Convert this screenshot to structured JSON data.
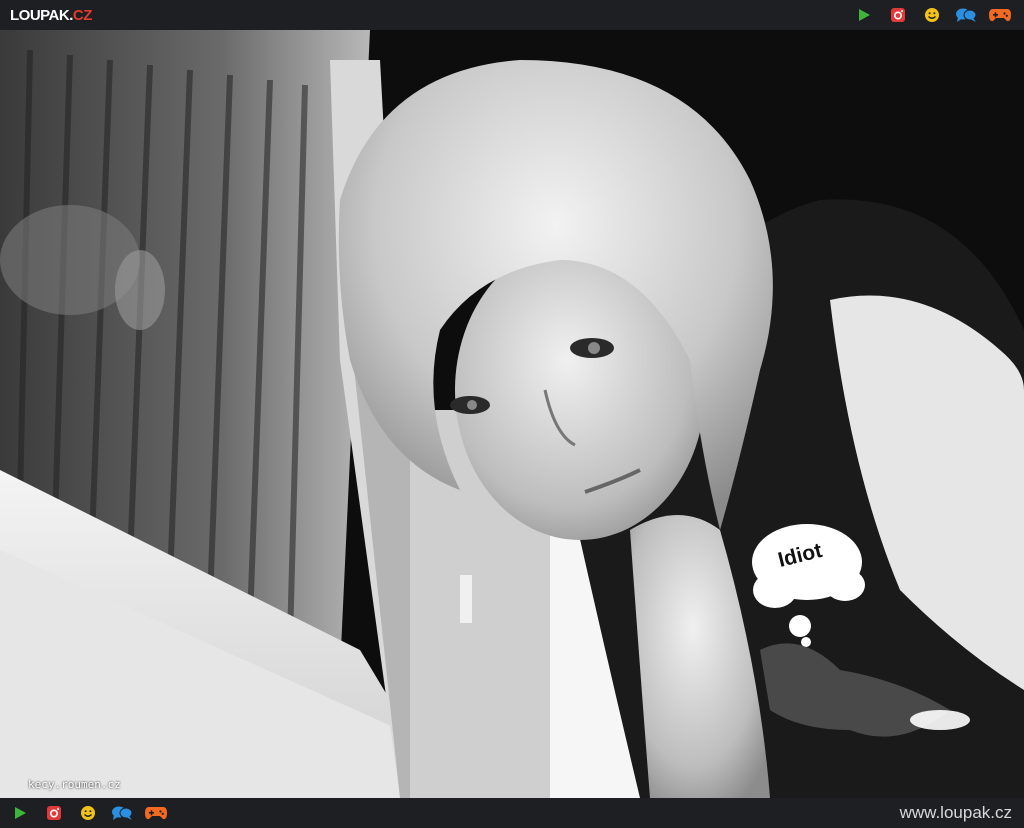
{
  "header": {
    "logo_main": "LOUPAK.",
    "logo_tld": "CZ"
  },
  "icons": [
    "play-icon",
    "instagram-icon",
    "smiley-icon",
    "chat-icon",
    "gamepad-icon"
  ],
  "colors": {
    "bar_bg": "#1e1f22",
    "play": "#3fb43b",
    "instagram": "#e2393a",
    "smiley": "#f2c21b",
    "chat": "#2a8fe0",
    "gamepad": "#f26a22"
  },
  "photo": {
    "watermark": "kecy.roumen.cz",
    "shirt_text": "Idiot"
  },
  "footer": {
    "url": "www.loupak.cz"
  }
}
